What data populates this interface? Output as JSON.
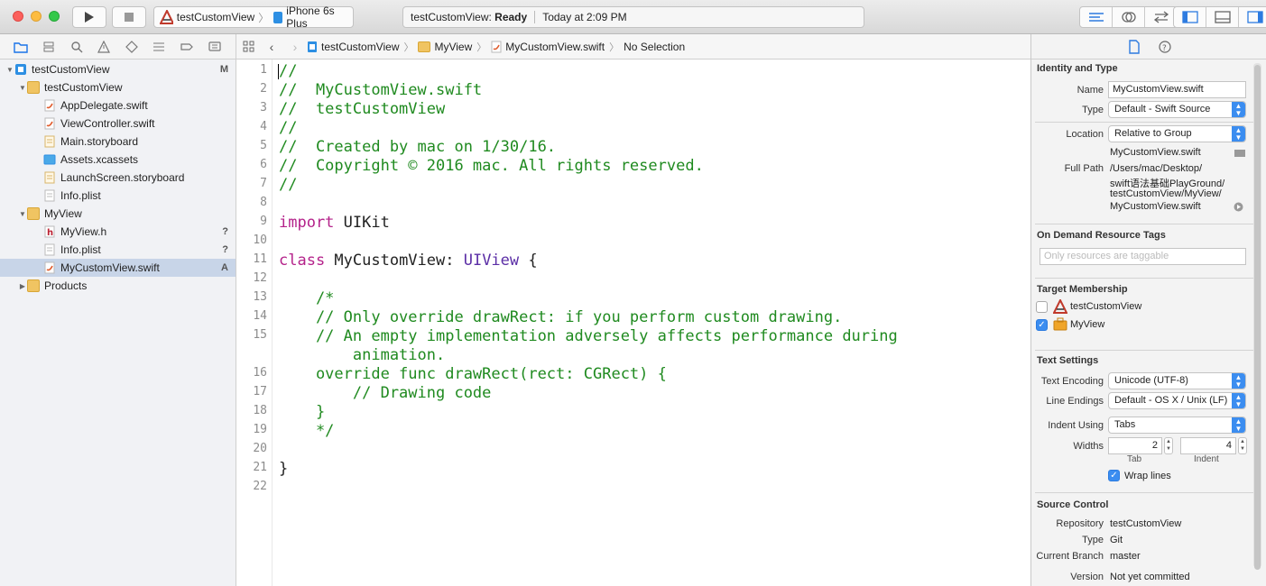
{
  "toolbar": {
    "scheme_project": "testCustomView",
    "scheme_device": "iPhone 6s Plus",
    "status_project": "testCustomView:",
    "status_state": "Ready",
    "status_time": "Today at 2:09 PM"
  },
  "navigator": {
    "items": [
      {
        "label": "testCustomView",
        "badge": "M"
      },
      {
        "label": "testCustomView",
        "badge": ""
      },
      {
        "label": "AppDelegate.swift",
        "badge": ""
      },
      {
        "label": "ViewController.swift",
        "badge": ""
      },
      {
        "label": "Main.storyboard",
        "badge": ""
      },
      {
        "label": "Assets.xcassets",
        "badge": ""
      },
      {
        "label": "LaunchScreen.storyboard",
        "badge": ""
      },
      {
        "label": "Info.plist",
        "badge": ""
      },
      {
        "label": "MyView",
        "badge": ""
      },
      {
        "label": "MyView.h",
        "badge": "?"
      },
      {
        "label": "Info.plist",
        "badge": "?"
      },
      {
        "label": "MyCustomView.swift",
        "badge": "A"
      },
      {
        "label": "Products",
        "badge": ""
      }
    ]
  },
  "breadcrumb": {
    "project": "testCustomView",
    "group": "MyView",
    "file": "MyCustomView.swift",
    "selection": "No Selection"
  },
  "editor": {
    "line_numbers": [
      "1",
      "2",
      "3",
      "4",
      "5",
      "6",
      "7",
      "8",
      "9",
      "10",
      "11",
      "12",
      "13",
      "14",
      "15",
      "",
      "16",
      "17",
      "18",
      "19",
      "20",
      "21",
      "22"
    ],
    "l1": "//",
    "l2": "//  MyCustomView.swift",
    "l3": "//  testCustomView",
    "l4": "//",
    "l5": "//  Created by mac on 1/30/16.",
    "l6": "//  Copyright © 2016 mac. All rights reserved.",
    "l7": "//",
    "l9_kw": "import",
    "l9_rest": " UIKit",
    "l11_kw": "class",
    "l11_name": " MyCustomView: ",
    "l11_type": "UIView",
    "l11_rest": " {",
    "l13": "    /*",
    "l14": "    // Only override drawRect: if you perform custom drawing.",
    "l15": "    // An empty implementation adversely affects performance during",
    "l15b": "        animation.",
    "l16": "    override func drawRect(rect: CGRect) {",
    "l17": "        // Drawing code",
    "l18": "    }",
    "l19": "    */",
    "l21": "}"
  },
  "inspector": {
    "identity_title": "Identity and Type",
    "name_label": "Name",
    "name_value": "MyCustomView.swift",
    "type_label": "Type",
    "type_value": "Default - Swift Source",
    "location_label": "Location",
    "location_value": "Relative to Group",
    "location_file": "MyCustomView.swift",
    "fullpath_label": "Full Path",
    "fullpath_1": "/Users/mac/Desktop/",
    "fullpath_2": "swift语法基础PlayGround/",
    "fullpath_3": "testCustomView/MyView/",
    "fullpath_4": "MyCustomView.swift",
    "odr_title": "On Demand Resource Tags",
    "odr_placeholder": "Only resources are taggable",
    "target_title": "Target Membership",
    "target_1": "testCustomView",
    "target_2": "MyView",
    "text_title": "Text Settings",
    "encoding_label": "Text Encoding",
    "encoding_value": "Unicode (UTF-8)",
    "endings_label": "Line Endings",
    "endings_value": "Default - OS X / Unix (LF)",
    "indent_label": "Indent Using",
    "indent_value": "Tabs",
    "widths_label": "Widths",
    "tab_value": "2",
    "indent_width_value": "4",
    "tab_caption": "Tab",
    "indent_caption": "Indent",
    "wrap_label": "Wrap lines",
    "sc_title": "Source Control",
    "repo_label": "Repository",
    "repo_value": "testCustomView",
    "sctype_label": "Type",
    "sctype_value": "Git",
    "branch_label": "Current Branch",
    "branch_value": "master",
    "version_label": "Version",
    "version_value": "Not yet committed"
  },
  "colors": {
    "comment": "#1f8a1f",
    "keyword": "#b4228a",
    "type": "#5b2ea6",
    "accent": "#3b8df0",
    "selection": "#c8d5e8"
  }
}
